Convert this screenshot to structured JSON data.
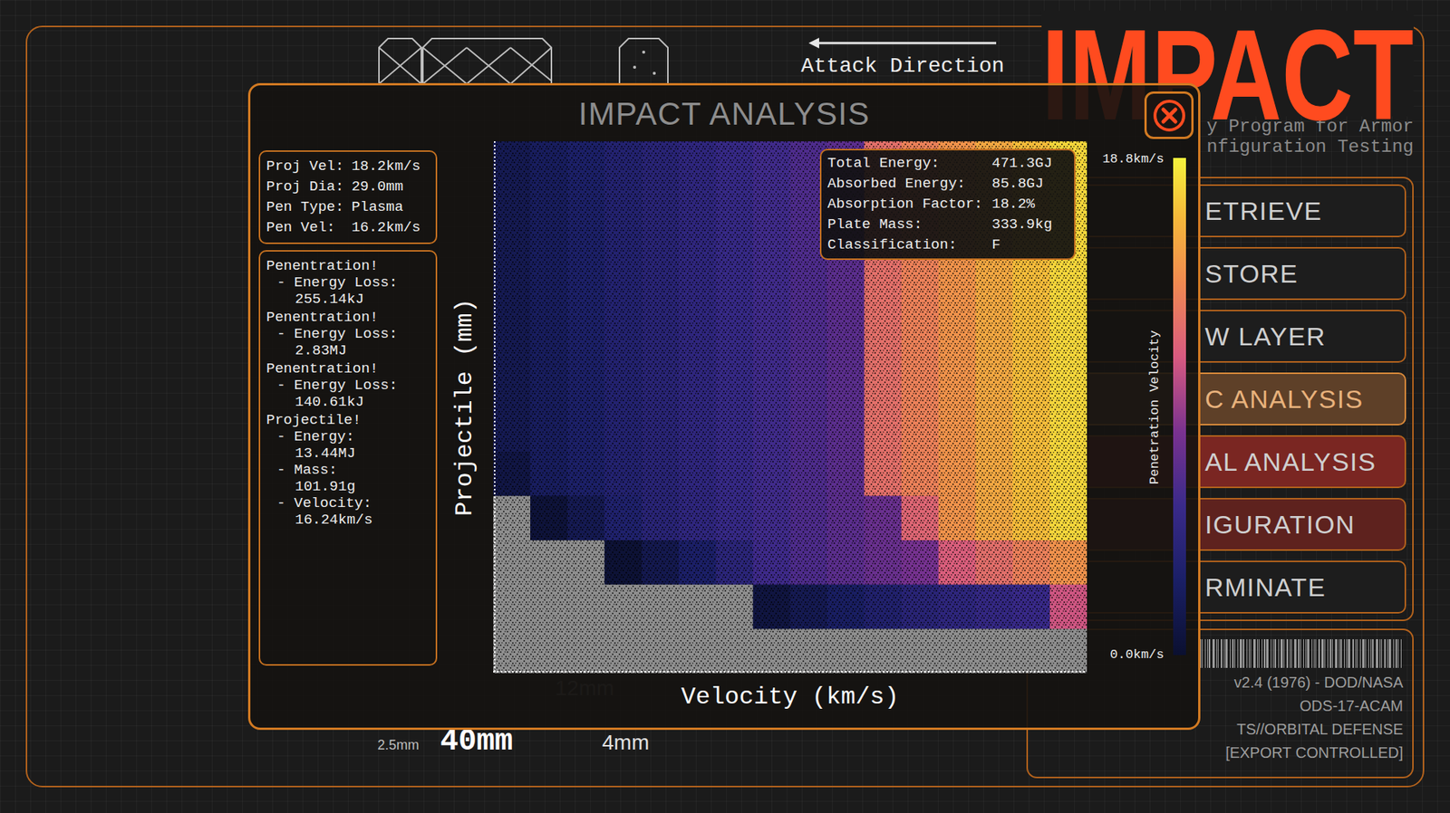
{
  "app": {
    "logo": "IMPACT",
    "subtitle": [
      "y Program for Armor",
      "nfiguration Testing"
    ]
  },
  "armor_diagram": {
    "attack_direction": "Attack Direction",
    "dimensions": [
      {
        "label": "2.5mm",
        "kind": "small"
      },
      {
        "label": "40mm",
        "kind": "large"
      },
      {
        "label": "12mm",
        "kind": "faded"
      },
      {
        "label": "4mm",
        "kind": "medium"
      }
    ]
  },
  "menu": [
    {
      "label": "ETRIEVE",
      "selected": false,
      "color": "#1d1d1d"
    },
    {
      "label": "STORE",
      "selected": false,
      "color": "#1d1d1d"
    },
    {
      "label": "W LAYER",
      "selected": false,
      "color": "#1d1d1d"
    },
    {
      "label": "C ANALYSIS",
      "selected": true,
      "color": "#5e4028"
    },
    {
      "label": "AL ANALYSIS",
      "selected": false,
      "color": "#7a2622"
    },
    {
      "label": "IGURATION",
      "selected": false,
      "color": "#5e221e"
    },
    {
      "label": "RMINATE",
      "selected": false,
      "color": "#1d1d1d"
    }
  ],
  "version_info": [
    "v2.4 (1976) - DOD/NASA",
    "ODS-17-ACAM",
    "TS//ORBITAL DEFENSE",
    "[EXPORT CONTROLLED]"
  ],
  "dialog": {
    "title": "IMPACT ANALYSIS",
    "projectile": [
      {
        "label": "Proj Vel:",
        "value": "18.2km/s"
      },
      {
        "label": "Proj Dia:",
        "value": "29.0mm"
      },
      {
        "label": "Pen Type:",
        "value": "Plasma"
      },
      {
        "label": "Pen Vel:",
        "value": "16.2km/s"
      }
    ],
    "log": [
      {
        "title": "Penentration!",
        "details": [
          {
            "label": "- Energy Loss:",
            "value": "255.14kJ"
          }
        ]
      },
      {
        "title": "Penentration!",
        "details": [
          {
            "label": "- Energy Loss:",
            "value": "2.83MJ"
          }
        ]
      },
      {
        "title": "Penentration!",
        "details": [
          {
            "label": "- Energy Loss:",
            "value": "140.61kJ"
          }
        ]
      },
      {
        "title": "Projectile!",
        "details": [
          {
            "label": "- Energy:",
            "value": "13.44MJ"
          },
          {
            "label": "- Mass:",
            "value": "101.91g"
          },
          {
            "label": "- Velocity:",
            "value": "16.24km/s"
          }
        ]
      }
    ],
    "stats": [
      {
        "label": "Total Energy:",
        "value": "471.3GJ"
      },
      {
        "label": "Absorbed Energy:",
        "value": "85.8GJ"
      },
      {
        "label": "Absorption Factor:",
        "value": "18.2%"
      },
      {
        "label": "Plate Mass:",
        "value": "333.9kg"
      },
      {
        "label": "Classification:",
        "value": "F"
      }
    ],
    "chart": {
      "x_label": "Velocity (km/s)",
      "y_label": "Projectile (mm)",
      "legend": {
        "title": "Penetration Velocity",
        "max_label": "18.8km/s",
        "min_label": "0.0km/s",
        "max": 18.8,
        "min": 0
      },
      "rows": [
        [
          1.8,
          2.4,
          3.0,
          3.6,
          4.1,
          4.7,
          5.3,
          5.9,
          6.5,
          7.1,
          12.6,
          13.6,
          14.6,
          15.7,
          16.7,
          17.7
        ],
        [
          1.8,
          2.4,
          3.0,
          3.6,
          4.1,
          4.7,
          5.3,
          5.9,
          6.5,
          7.1,
          12.6,
          13.6,
          14.6,
          15.7,
          16.7,
          17.7
        ],
        [
          1.8,
          2.4,
          3.0,
          3.6,
          4.1,
          4.7,
          5.3,
          5.9,
          6.5,
          7.1,
          12.6,
          13.6,
          14.6,
          15.7,
          16.7,
          17.7
        ],
        [
          1.8,
          2.4,
          3.0,
          3.6,
          4.1,
          4.7,
          5.3,
          5.9,
          6.5,
          7.1,
          12.6,
          13.6,
          14.6,
          15.7,
          16.7,
          17.7
        ],
        [
          1.8,
          2.4,
          3.0,
          3.6,
          4.1,
          4.7,
          5.3,
          5.9,
          6.5,
          7.1,
          12.6,
          13.6,
          14.6,
          15.7,
          16.7,
          17.7
        ],
        [
          1.8,
          2.4,
          3.0,
          3.6,
          4.1,
          4.7,
          5.3,
          5.9,
          6.5,
          7.1,
          12.6,
          13.6,
          14.6,
          15.7,
          16.7,
          17.7
        ],
        [
          1.8,
          2.4,
          3.0,
          3.6,
          4.1,
          4.7,
          5.3,
          5.9,
          6.5,
          7.1,
          12.6,
          13.6,
          14.6,
          15.7,
          16.7,
          17.7
        ],
        [
          1.1,
          2.4,
          3.0,
          3.6,
          4.1,
          4.7,
          5.3,
          5.9,
          6.5,
          7.1,
          12.6,
          13.6,
          14.6,
          15.7,
          16.7,
          17.7
        ],
        [
          null,
          0.5,
          1.8,
          3.3,
          4.1,
          4.7,
          5.3,
          5.9,
          6.5,
          7.1,
          7.7,
          12.0,
          14.6,
          15.7,
          16.7,
          17.7
        ],
        [
          null,
          null,
          null,
          0.3,
          1.6,
          2.9,
          4.3,
          5.8,
          6.5,
          7.1,
          7.7,
          8.3,
          11.5,
          12.5,
          13.5,
          14.5
        ],
        [
          null,
          null,
          null,
          null,
          null,
          null,
          null,
          0.9,
          1.8,
          2.6,
          3.4,
          4.1,
          4.6,
          5.1,
          5.5,
          11.0
        ],
        [
          null,
          null,
          null,
          null,
          null,
          null,
          null,
          null,
          null,
          null,
          null,
          null,
          null,
          null,
          null,
          null
        ]
      ]
    }
  }
}
